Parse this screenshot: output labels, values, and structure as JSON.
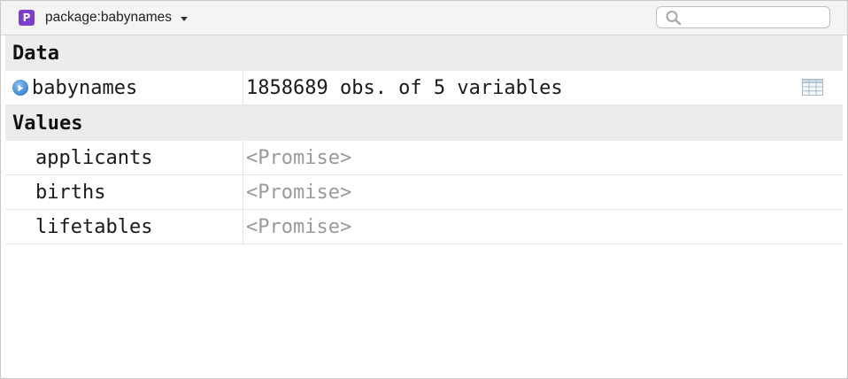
{
  "toolbar": {
    "environment_label": "package:babynames",
    "package_badge": "P",
    "search_placeholder": ""
  },
  "sections": {
    "data_heading": "Data",
    "values_heading": "Values"
  },
  "data_rows": [
    {
      "name": "babynames",
      "value": "1858689 obs. of 5 variables"
    }
  ],
  "value_rows": [
    {
      "name": "applicants",
      "value": "<Promise>"
    },
    {
      "name": "births",
      "value": "<Promise>"
    },
    {
      "name": "lifetables",
      "value": "<Promise>"
    }
  ],
  "colors": {
    "package_badge": "#7b3fcf",
    "expand_button": "#3b86cf",
    "section_background": "#ececec",
    "promise_text": "#9a9a9a"
  },
  "icons": {
    "environment": "package-badge-icon",
    "dropdown": "caret-down-icon",
    "search": "search-icon",
    "expand": "expand-arrow-icon",
    "view_data": "table-grid-icon"
  }
}
